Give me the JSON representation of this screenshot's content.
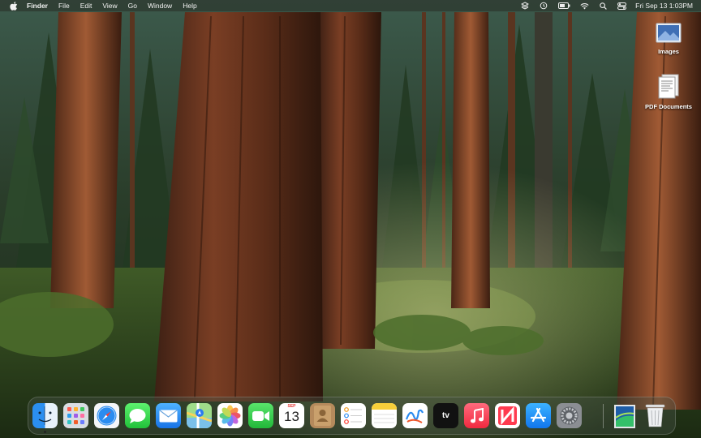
{
  "menubar": {
    "app_name": "Finder",
    "menus": [
      "File",
      "Edit",
      "View",
      "Go",
      "Window",
      "Help"
    ],
    "clock": "Fri Sep 13  1:03PM",
    "status_icons": [
      "layers-icon",
      "time-machine-icon",
      "battery-icon",
      "wifi-icon",
      "spotlight-search-icon",
      "control-center-icon"
    ]
  },
  "desktop": {
    "icons": [
      {
        "label": "Images",
        "icon": "images-folder-icon"
      },
      {
        "label": "PDF Documents",
        "icon": "pdf-documents-icon"
      }
    ]
  },
  "dock": {
    "apps": [
      {
        "name": "Finder",
        "icon": "finder-icon",
        "running": true
      },
      {
        "name": "Launchpad",
        "icon": "launchpad-icon",
        "running": false
      },
      {
        "name": "Safari",
        "icon": "safari-icon",
        "running": false
      },
      {
        "name": "Messages",
        "icon": "messages-icon",
        "running": false
      },
      {
        "name": "Mail",
        "icon": "mail-icon",
        "running": false
      },
      {
        "name": "Maps",
        "icon": "maps-icon",
        "running": false
      },
      {
        "name": "Photos",
        "icon": "photos-icon",
        "running": false
      },
      {
        "name": "FaceTime",
        "icon": "facetime-icon",
        "running": false
      },
      {
        "name": "Calendar",
        "icon": "calendar-icon",
        "running": false
      },
      {
        "name": "Contacts",
        "icon": "contacts-icon",
        "running": false
      },
      {
        "name": "Reminders",
        "icon": "reminders-icon",
        "running": false
      },
      {
        "name": "Notes",
        "icon": "notes-icon",
        "running": false
      },
      {
        "name": "Freeform",
        "icon": "freeform-icon",
        "running": false
      },
      {
        "name": "TV",
        "icon": "apple-tv-icon",
        "running": false
      },
      {
        "name": "Music",
        "icon": "music-icon",
        "running": false
      },
      {
        "name": "News",
        "icon": "news-icon",
        "running": false
      },
      {
        "name": "App Store",
        "icon": "app-store-icon",
        "running": false
      },
      {
        "name": "System Settings",
        "icon": "system-settings-icon",
        "running": false
      },
      {
        "name": "Downloads",
        "icon": "downloads-stack-icon",
        "running": false
      },
      {
        "name": "Trash",
        "icon": "trash-icon",
        "running": false
      }
    ],
    "calendar": {
      "month": "SEP",
      "day": "13"
    },
    "tv_label": "tv"
  }
}
